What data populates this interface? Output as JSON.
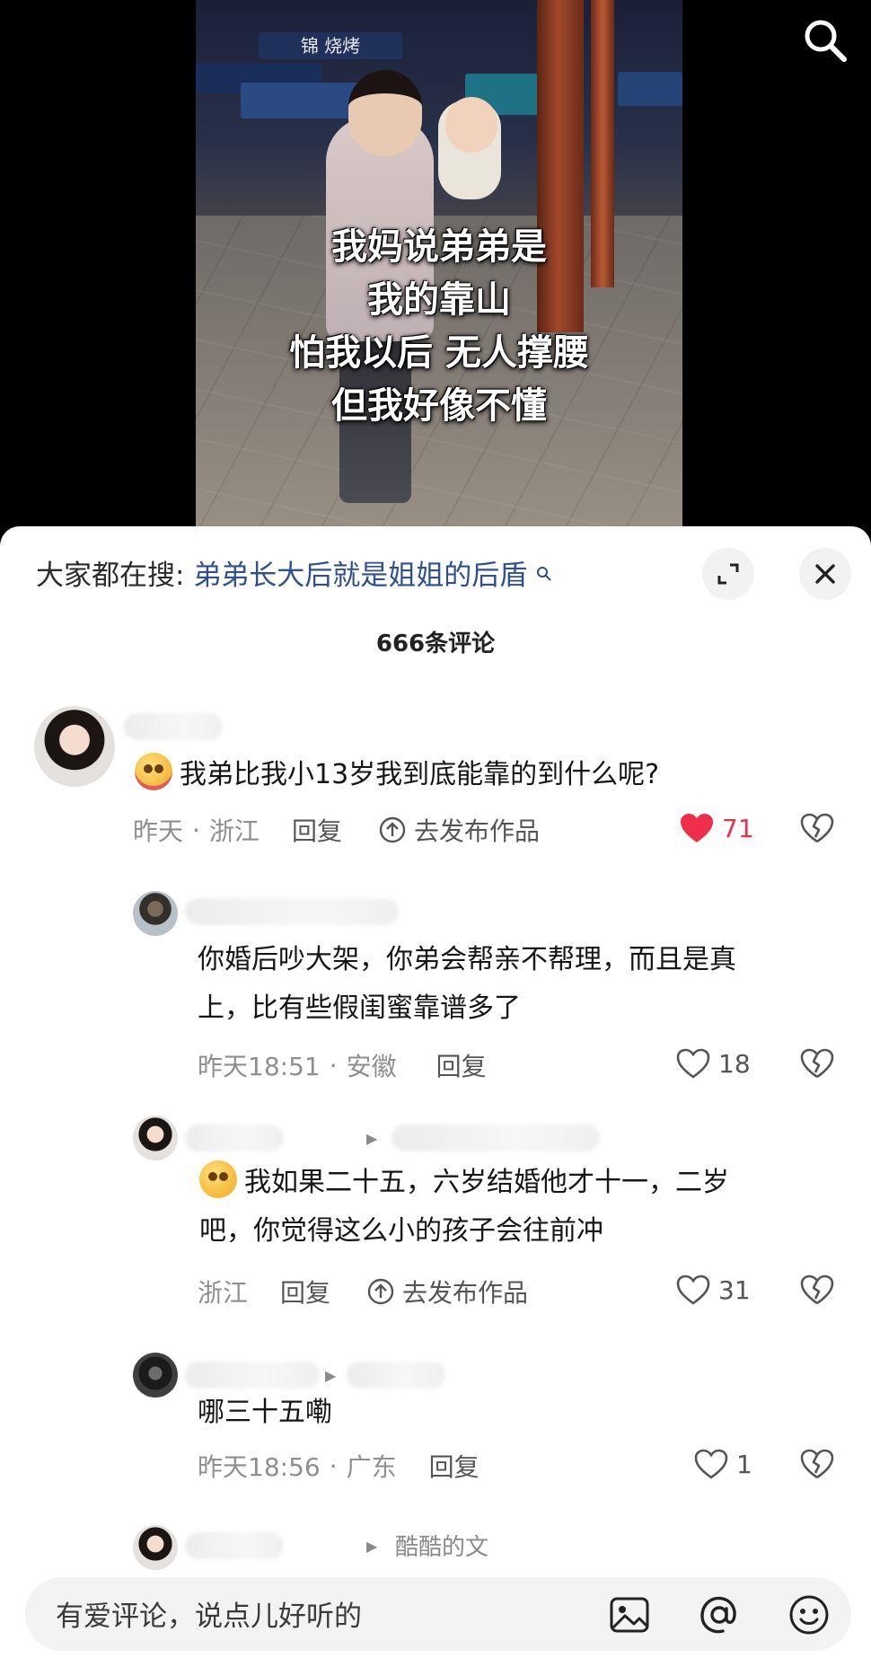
{
  "video": {
    "overlay_lines": [
      "我妈说弟弟是",
      "我的靠山",
      "怕我以后 无人撑腰",
      "但我好像不懂"
    ],
    "sign_text": "锦 烧烤",
    "search_icon": "search-icon"
  },
  "sheet": {
    "search_prefix": "大家都在搜:",
    "search_term": "弟弟长大后就是姐姐的后盾",
    "expand_icon": "expand-icon",
    "close_icon": "close-icon",
    "comment_count": "666条评论"
  },
  "comments": [
    {
      "text": "我弟比我小13岁我到底能靠的到什么呢?",
      "meta": {
        "time": "昨天",
        "location": "浙江",
        "reply": "回复",
        "publish": "去发布作品"
      },
      "likes": "71",
      "liked": true
    }
  ],
  "replies": [
    {
      "text": [
        "你婚后吵大架，你弟会帮亲不帮理，而且是真",
        "上，比有些假闺蜜靠谱多了"
      ],
      "meta": {
        "time": "昨天18:51",
        "location": "安徽",
        "reply": "回复"
      },
      "likes": "18"
    },
    {
      "text": [
        "我如果二十五，六岁结婚他才十一，二岁",
        "吧，你觉得这么小的孩子会往前冲"
      ],
      "meta": {
        "location": "浙江",
        "reply": "回复",
        "publish": "去发布作品"
      },
      "likes": "31"
    },
    {
      "text": [
        "哪三十五嘞"
      ],
      "meta": {
        "time": "昨天18:56",
        "location": "广东",
        "reply": "回复"
      },
      "likes": "1"
    },
    {
      "reply_to": "酷酷的文"
    }
  ],
  "input": {
    "placeholder": "有爱评论，说点儿好听的",
    "icons": [
      "image-icon",
      "at-icon",
      "emoji-icon"
    ]
  },
  "colors": {
    "accent_link": "#2f4f8f",
    "like_red": "#ee2e4a",
    "meta_gray": "#8f8f8f"
  }
}
